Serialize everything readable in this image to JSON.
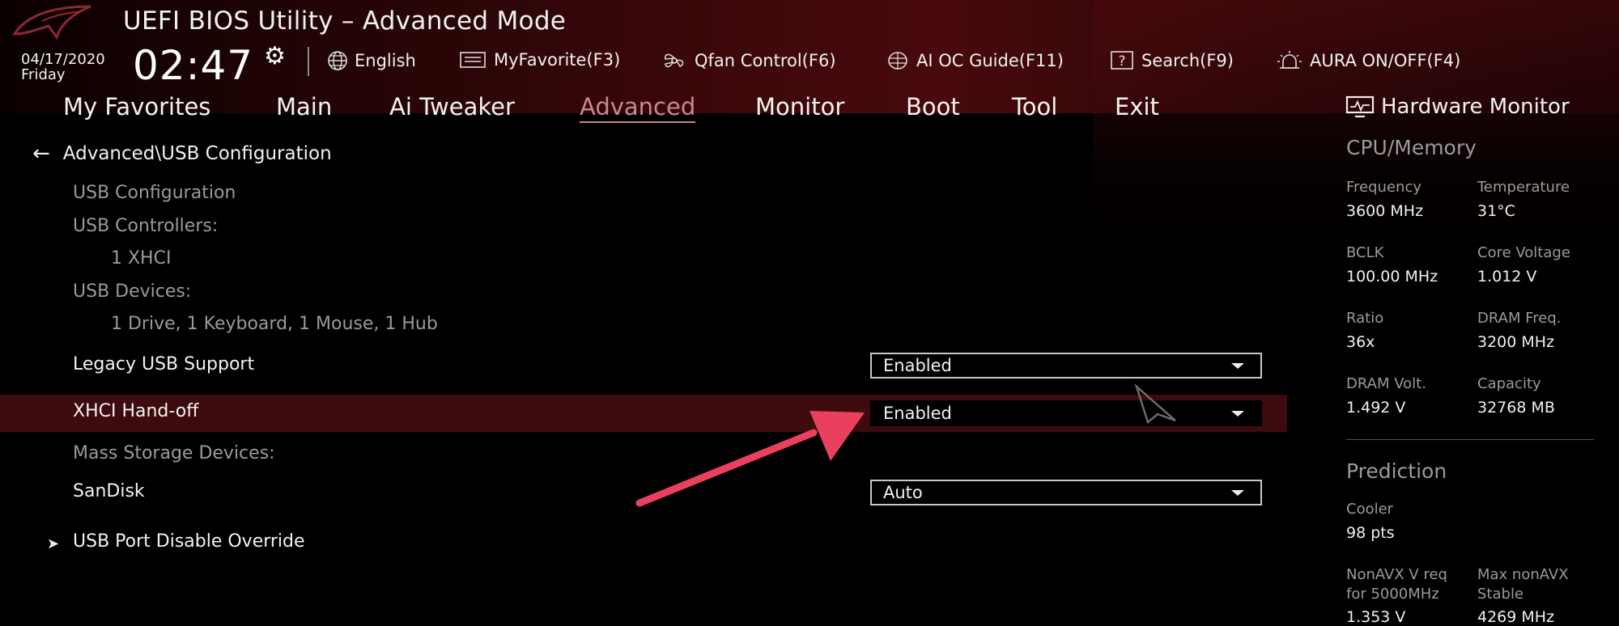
{
  "header": {
    "title": "UEFI BIOS Utility – Advanced Mode",
    "date": "04/17/2020",
    "day": "Friday",
    "time": "02:47",
    "toolbar": [
      {
        "icon": "globe-icon",
        "label": "English"
      },
      {
        "icon": "favorite-list-icon",
        "label": "MyFavorite(F3)"
      },
      {
        "icon": "fan-icon",
        "label": "Qfan Control(F6)"
      },
      {
        "icon": "ai-chip-icon",
        "label": "AI OC Guide(F11)"
      },
      {
        "icon": "search-help-icon",
        "label": "Search(F9)"
      },
      {
        "icon": "aura-light-icon",
        "label": "AURA ON/OFF(F4)"
      }
    ]
  },
  "nav": {
    "tabs": [
      "My Favorites",
      "Main",
      "Ai Tweaker",
      "Advanced",
      "Monitor",
      "Boot",
      "Tool",
      "Exit"
    ],
    "active": "Advanced"
  },
  "breadcrumb": "Advanced\\USB Configuration",
  "settings": {
    "usb_config_heading": "USB Configuration",
    "usb_controllers_label": "USB Controllers:",
    "usb_controllers_value": "1 XHCI",
    "usb_devices_label": "USB Devices:",
    "usb_devices_value": "1 Drive, 1 Keyboard, 1 Mouse, 1 Hub",
    "legacy_usb": {
      "label": "Legacy USB Support",
      "value": "Enabled"
    },
    "xhci_handoff": {
      "label": "XHCI Hand-off",
      "value": "Enabled"
    },
    "mass_storage_label": "Mass Storage Devices:",
    "sandisk": {
      "label": "SanDisk",
      "value": "Auto"
    },
    "port_disable_override": "USB Port Disable Override"
  },
  "hardware_monitor": {
    "title": "Hardware Monitor",
    "cpu_memory": {
      "heading": "CPU/Memory",
      "frequency": {
        "label": "Frequency",
        "value": "3600 MHz"
      },
      "temperature": {
        "label": "Temperature",
        "value": "31°C"
      },
      "bclk": {
        "label": "BCLK",
        "value": "100.00 MHz"
      },
      "core_voltage": {
        "label": "Core Voltage",
        "value": "1.012 V"
      },
      "ratio": {
        "label": "Ratio",
        "value": "36x"
      },
      "dram_freq": {
        "label": "DRAM Freq.",
        "value": "3200 MHz"
      },
      "dram_volt": {
        "label": "DRAM Volt.",
        "value": "1.492 V"
      },
      "capacity": {
        "label": "Capacity",
        "value": "32768 MB"
      }
    },
    "prediction": {
      "heading": "Prediction",
      "cooler": {
        "label": "Cooler",
        "value": "98 pts"
      },
      "nonavx_vreq": {
        "label_line1": "NonAVX V req",
        "label_line2": "for 5000MHz",
        "value": "1.353 V"
      },
      "max_nonavx": {
        "label_line1": "Max nonAVX",
        "label_line2": "Stable",
        "value": "4269 MHz"
      }
    }
  },
  "colors": {
    "highlight_row": "#3d0a0d",
    "active_tab": "#c9878f",
    "annotation_arrow": "#e8405e"
  }
}
